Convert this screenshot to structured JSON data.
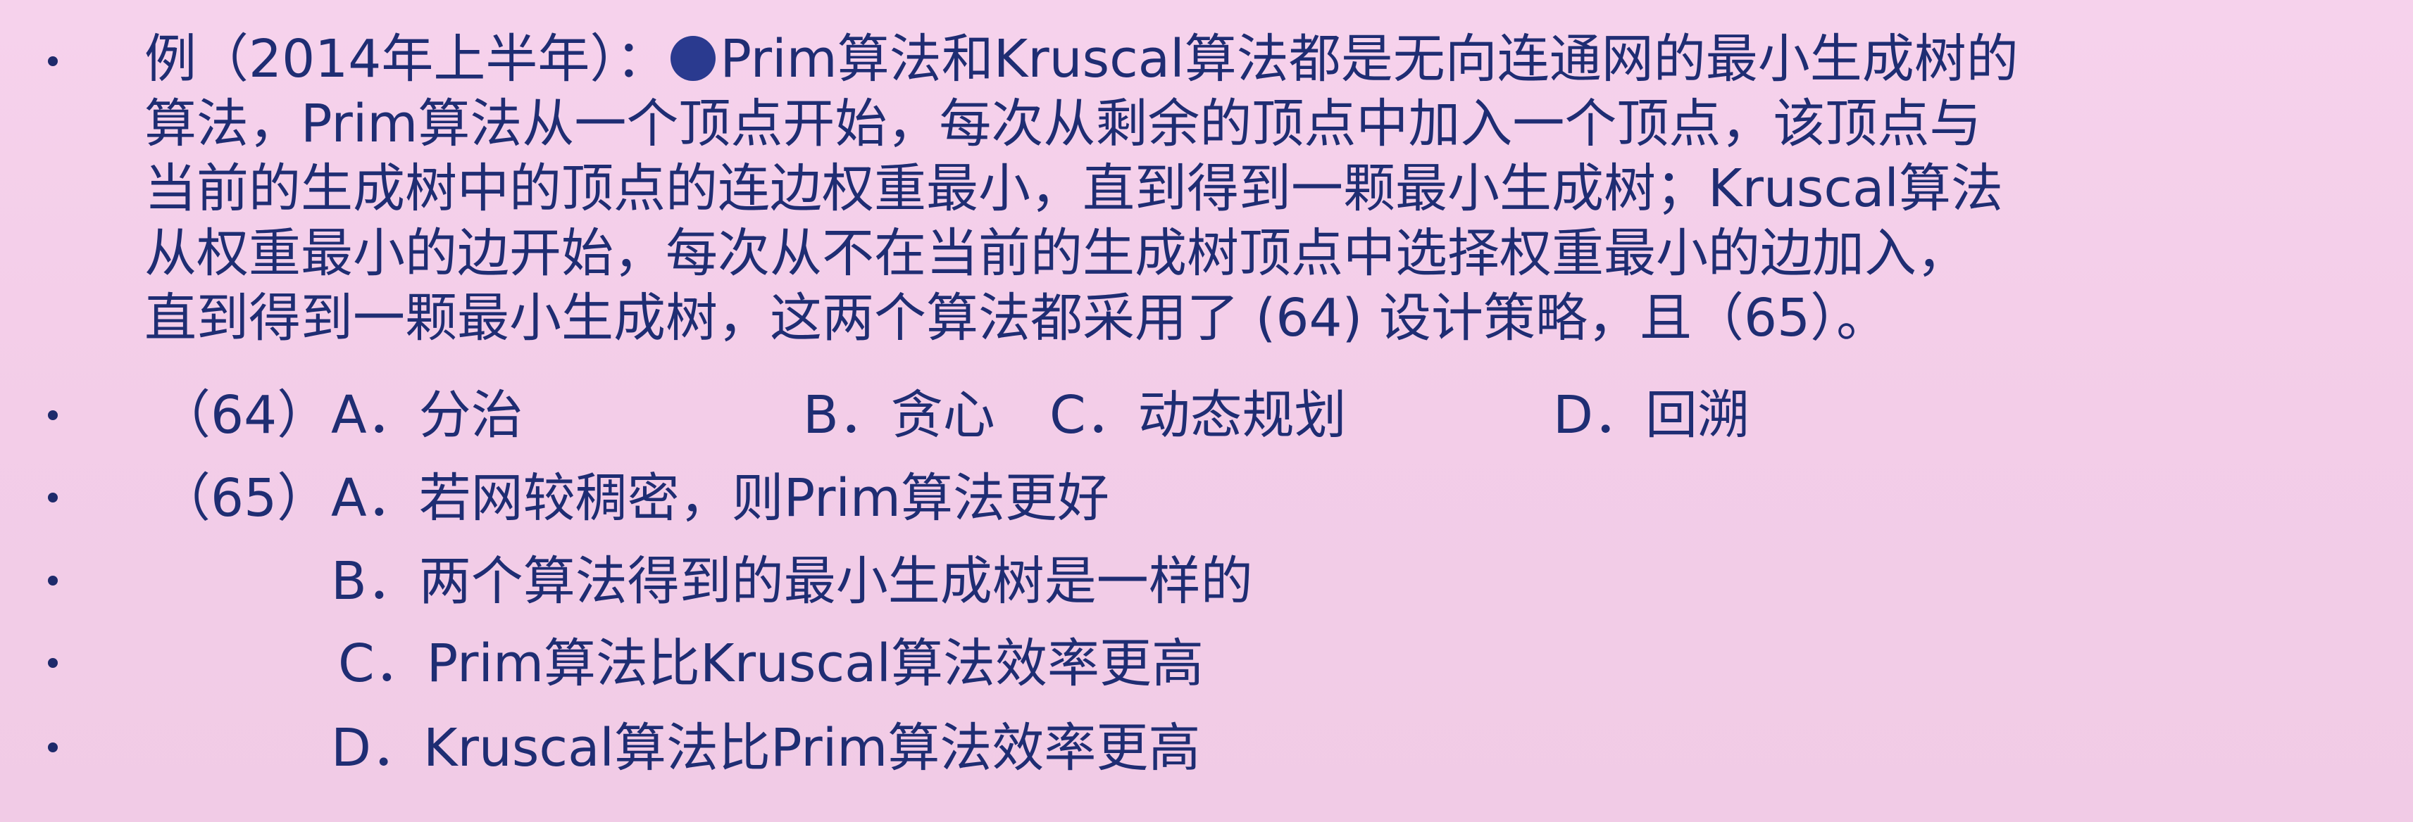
{
  "question": {
    "prefix": "例（2014年上半年）：",
    "line1": "Prim算法和Kruscal算法都是无向连通网的最小生成树的",
    "line2": "算法，Prim算法从一个顶点开始，每次从剩余的顶点中加入一个顶点，该顶点与",
    "line3": "当前的生成树中的顶点的连边权重最小，直到得到一颗最小生成树；Kruscal算法",
    "line4": "从权重最小的边开始，每次从不在当前的生成树顶点中选择权重最小的边加入，",
    "line5": "直到得到一颗最小生成树，这两个算法都采用了 (64) 设计策略，且（65）。",
    "icon": "blue-dot-icon"
  },
  "q64": {
    "label": "（64）",
    "a": "A．分治",
    "b": "B．贪心",
    "c": "C．动态规划",
    "d": "D．回溯"
  },
  "q65": {
    "label": "（65）",
    "a": "A．若网较稠密，则Prim算法更好",
    "b": "B．两个算法得到的最小生成树是一样的",
    "c": "C．Prim算法比Kruscal算法效率更高",
    "d": "D．Kruscal算法比Prim算法效率更高"
  },
  "colors": {
    "text": "#1f2d73",
    "background": "#f4cfea",
    "bullet": "#1e2a6b"
  }
}
